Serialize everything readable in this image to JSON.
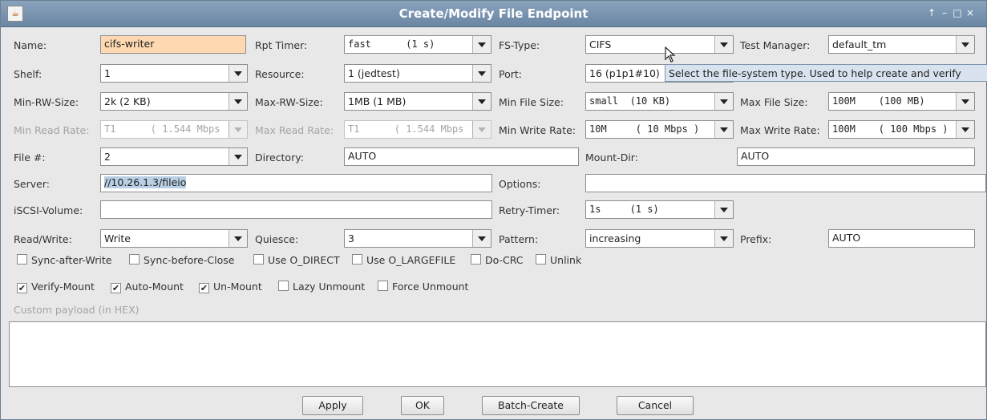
{
  "window": {
    "title": "Create/Modify File Endpoint",
    "controls": [
      "↑",
      "–",
      "□",
      "×"
    ]
  },
  "row1": {
    "name_label": "Name:",
    "name_value": "cifs-writer",
    "rpt_timer_label": "Rpt Timer:",
    "rpt_timer_value": "fast      (1 s)",
    "fs_type_label": "FS-Type:",
    "fs_type_value": "CIFS",
    "test_manager_label": "Test Manager:",
    "test_manager_value": "default_tm"
  },
  "row2": {
    "shelf_label": "Shelf:",
    "shelf_value": "1",
    "resource_label": "Resource:",
    "resource_value": "1 (jedtest)",
    "port_label": "Port:",
    "port_value": "16 (p1p1#10)"
  },
  "tooltip": "Select the file-system type.  Used to help create and verify",
  "row3": {
    "min_rw_label": "Min-RW-Size:",
    "min_rw_value": "2k (2 KB)",
    "max_rw_label": "Max-RW-Size:",
    "max_rw_value": "1MB (1 MB)",
    "min_file_label": "Min File Size:",
    "min_file_value": "small  (10 KB)",
    "max_file_label": "Max File Size:",
    "max_file_value": "100M    (100 MB)"
  },
  "row4": {
    "min_read_label": "Min Read Rate:",
    "min_read_value": "T1      ( 1.544 Mbps )",
    "max_read_label": "Max Read Rate:",
    "max_read_value": "T1      ( 1.544 Mbps )",
    "min_write_label": "Min Write Rate:",
    "min_write_value": "10M     ( 10 Mbps )",
    "max_write_label": "Max Write Rate:",
    "max_write_value": "100M    ( 100 Mbps )"
  },
  "row5": {
    "file_num_label": "File #:",
    "file_num_value": "2",
    "directory_label": "Directory:",
    "directory_value": "AUTO",
    "mount_dir_label": "Mount-Dir:",
    "mount_dir_value": "AUTO"
  },
  "row6": {
    "server_label": "Server:",
    "server_value": "//10.26.1.3/fileio",
    "options_label": "Options:",
    "options_value": ""
  },
  "row7": {
    "iscsi_label": "iSCSI-Volume:",
    "iscsi_value": "",
    "retry_label": "Retry-Timer:",
    "retry_value": "1s     (1 s)"
  },
  "row8": {
    "rw_label": "Read/Write:",
    "rw_value": "Write",
    "quiesce_label": "Quiesce:",
    "quiesce_value": "3",
    "pattern_label": "Pattern:",
    "pattern_value": "increasing",
    "prefix_label": "Prefix:",
    "prefix_value": "AUTO"
  },
  "checks1": [
    {
      "label": "Sync-after-Write",
      "checked": false
    },
    {
      "label": "Sync-before-Close",
      "checked": false
    },
    {
      "label": "Use O_DIRECT",
      "checked": false
    },
    {
      "label": "Use O_LARGEFILE",
      "checked": false
    },
    {
      "label": "Do-CRC",
      "checked": false
    },
    {
      "label": "Unlink",
      "checked": false
    }
  ],
  "checks2": [
    {
      "label": "Verify-Mount",
      "checked": true
    },
    {
      "label": "Auto-Mount",
      "checked": true
    },
    {
      "label": "Un-Mount",
      "checked": true
    },
    {
      "label": "Lazy Unmount",
      "checked": false
    },
    {
      "label": "Force Unmount",
      "checked": false
    }
  ],
  "payload_label": "Custom payload (in HEX)",
  "payload_value": "",
  "buttons": {
    "apply": "Apply",
    "ok": "OK",
    "batch": "Batch-Create",
    "cancel": "Cancel"
  }
}
